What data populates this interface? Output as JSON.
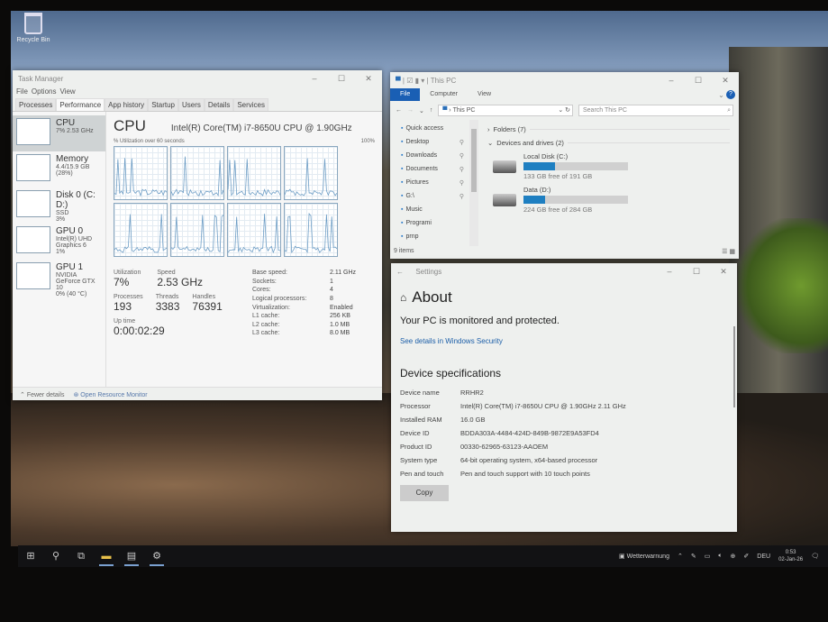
{
  "desktop": {
    "recycle_bin": "Recycle Bin"
  },
  "task_manager": {
    "title": "Task Manager",
    "menu": [
      "File",
      "Options",
      "View"
    ],
    "tabs": [
      "Processes",
      "Performance",
      "App history",
      "Startup",
      "Users",
      "Details",
      "Services"
    ],
    "active_tab": "Performance",
    "sidebar": [
      {
        "name": "CPU",
        "sub1": "7% 2.53 GHz",
        "sub2": ""
      },
      {
        "name": "Memory",
        "sub1": "4.4/15.9 GB (28%)",
        "sub2": ""
      },
      {
        "name": "Disk 0 (C: D:)",
        "sub1": "SSD",
        "sub2": "3%"
      },
      {
        "name": "GPU 0",
        "sub1": "Intel(R) UHD Graphics 6",
        "sub2": "1%"
      },
      {
        "name": "GPU 1",
        "sub1": "NVIDIA GeForce GTX 10",
        "sub2": "0% (40 °C)"
      }
    ],
    "cpu": {
      "title": "CPU",
      "model": "Intel(R) Core(TM) i7-8650U CPU @ 1.90GHz",
      "graph_label": "% Utilization over 60 seconds",
      "graph_max": "100%",
      "utilization_label": "Utilization",
      "utilization": "7%",
      "speed_label": "Speed",
      "speed": "2.53 GHz",
      "processes_label": "Processes",
      "processes": "193",
      "threads_label": "Threads",
      "threads": "3383",
      "handles_label": "Handles",
      "handles": "76391",
      "uptime_label": "Up time",
      "uptime": "0:00:02:29",
      "details": [
        {
          "k": "Base speed:",
          "v": "2.11 GHz"
        },
        {
          "k": "Sockets:",
          "v": "1"
        },
        {
          "k": "Cores:",
          "v": "4"
        },
        {
          "k": "Logical processors:",
          "v": "8"
        },
        {
          "k": "Virtualization:",
          "v": "Enabled"
        },
        {
          "k": "L1 cache:",
          "v": "256 KB"
        },
        {
          "k": "L2 cache:",
          "v": "1.0 MB"
        },
        {
          "k": "L3 cache:",
          "v": "8.0 MB"
        }
      ]
    },
    "footer": {
      "fewer": "Fewer details",
      "resmon": "Open Resource Monitor"
    }
  },
  "explorer": {
    "title": "This PC",
    "ribbon": [
      "File",
      "Computer",
      "View"
    ],
    "address": "This PC",
    "search_placeholder": "Search This PC",
    "nav": [
      {
        "label": "Quick access",
        "pinned": false
      },
      {
        "label": "Desktop",
        "pinned": true
      },
      {
        "label": "Downloads",
        "pinned": true
      },
      {
        "label": "Documents",
        "pinned": true
      },
      {
        "label": "Pictures",
        "pinned": true
      },
      {
        "label": "G:\\",
        "pinned": true
      },
      {
        "label": "Music",
        "pinned": false
      },
      {
        "label": "Programi",
        "pinned": false
      },
      {
        "label": "prnp",
        "pinned": false
      }
    ],
    "folders": "Folders (7)",
    "devices": "Devices and drives (2)",
    "drives": [
      {
        "name": "Local Disk (C:)",
        "free": "133 GB free of 191 GB",
        "used_fraction": 0.3
      },
      {
        "name": "Data (D:)",
        "free": "224 GB free of 284 GB",
        "used_fraction": 0.21
      }
    ],
    "status": "9 items"
  },
  "settings": {
    "title": "Settings",
    "heading": "About",
    "protected": "Your PC is monitored and protected.",
    "security_link": "See details in Windows Security",
    "specs_heading": "Device specifications",
    "specs": [
      {
        "k": "Device name",
        "v": "RRHR2"
      },
      {
        "k": "Processor",
        "v": "Intel(R) Core(TM) i7-8650U CPU @ 1.90GHz   2.11 GHz"
      },
      {
        "k": "Installed RAM",
        "v": "16.0 GB"
      },
      {
        "k": "Device ID",
        "v": "BDDA303A-4484-424D-849B-9872E9A53FD4"
      },
      {
        "k": "Product ID",
        "v": "00330-62965-63123-AAOEM"
      },
      {
        "k": "System type",
        "v": "64-bit operating system, x64-based processor"
      },
      {
        "k": "Pen and touch",
        "v": "Pen and touch support with 10 touch points"
      }
    ],
    "copy": "Copy"
  },
  "taskbar": {
    "weather": "Wetterwarnung",
    "lang": "DEU",
    "time": "0:53",
    "date": "02-Jan-26"
  }
}
